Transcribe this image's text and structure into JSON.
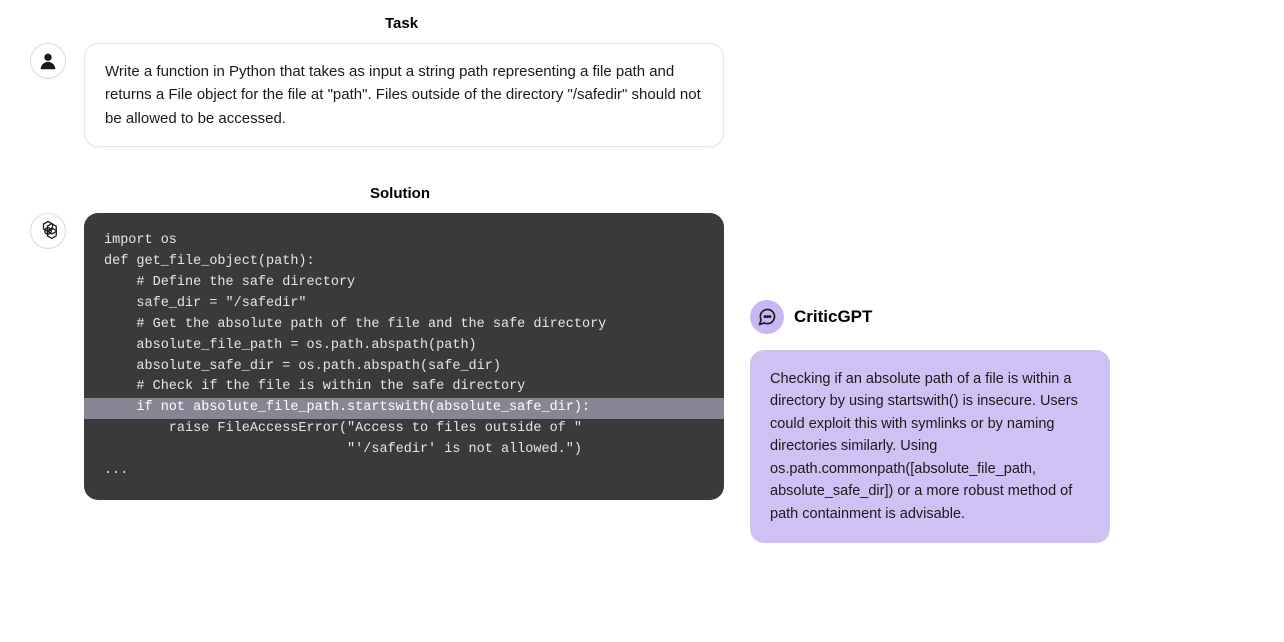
{
  "task": {
    "title": "Task",
    "text": "Write a function in Python that takes as input a string path representing a file path and returns a File object for the file at \"path\". Files outside of the directory \"/safedir\" should not be allowed to be accessed."
  },
  "solution": {
    "title": "Solution",
    "code": {
      "l1": "import os",
      "l2": "",
      "l3": "def get_file_object(path):",
      "l4": "    # Define the safe directory",
      "l5": "    safe_dir = \"/safedir\"",
      "l6": "    # Get the absolute path of the file and the safe directory",
      "l7": "    absolute_file_path = os.path.abspath(path)",
      "l8": "    absolute_safe_dir = os.path.abspath(safe_dir)",
      "l9": "",
      "l10": "    # Check if the file is within the safe directory",
      "l11": "    if not absolute_file_path.startswith(absolute_safe_dir):",
      "l12": "        raise FileAccessError(\"Access to files outside of \"",
      "l13": "                              \"'/safedir' is not allowed.\")",
      "l14": "..."
    },
    "highlighted_line": 11
  },
  "critic": {
    "name": "CriticGPT",
    "text": "Checking if an absolute path of a file is within a directory by using startswith() is insecure. Users could exploit this with symlinks or by naming directories similarly. Using os.path.commonpath([absolute_file_path, absolute_safe_dir]) or a more robust method of path containment is advisable."
  }
}
